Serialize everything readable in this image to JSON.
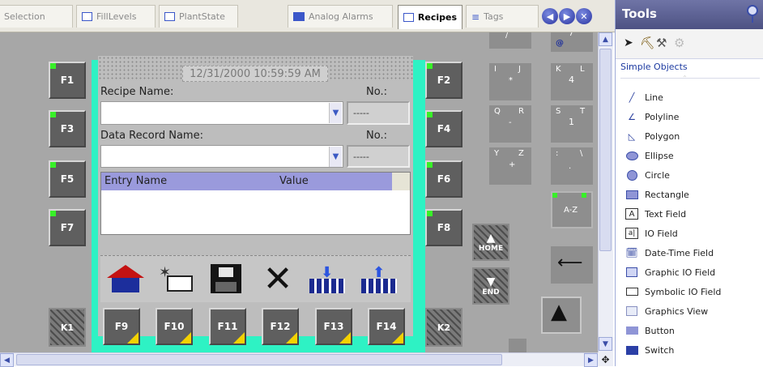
{
  "tabs": [
    {
      "label": "Selection",
      "active": false
    },
    {
      "label": "FillLevels",
      "active": false
    },
    {
      "label": "PlantState",
      "active": false
    },
    {
      "label": "Analog Alarms",
      "active": false
    },
    {
      "label": "Recipes",
      "active": true
    },
    {
      "label": "Tags",
      "active": false
    }
  ],
  "nav": {
    "back": "◀",
    "forward": "▶",
    "close": "✕"
  },
  "panel": {
    "left_keys": [
      "F1",
      "F3",
      "F5",
      "F7"
    ],
    "right_keys": [
      "F2",
      "F4",
      "F6",
      "F8"
    ],
    "bottom_keys": [
      "F9",
      "F10",
      "F11",
      "F12",
      "F13",
      "F14"
    ],
    "corner_keys": [
      "K1",
      "K2"
    ],
    "home_label": "HOME",
    "end_label": "END",
    "az_label": "A-Z"
  },
  "recipe_view": {
    "datetime": "12/31/2000 10:59:59 AM",
    "recipe_name_label": "Recipe Name:",
    "no_label_1": "No.:",
    "recipe_no_value": "-----",
    "record_name_label": "Data Record Name:",
    "no_label_2": "No.:",
    "record_no_value": "-----",
    "col_entry": "Entry Name",
    "col_value": "Value"
  },
  "keypad": {
    "k1": {
      "top": "I",
      "top2": "J",
      "mid": "*"
    },
    "k2": {
      "top": "K",
      "top2": "L",
      "mid": "4"
    },
    "k3": {
      "top": "Q",
      "top2": "R",
      "mid": "-"
    },
    "k4": {
      "top": "S",
      "top2": "T",
      "mid": "1"
    },
    "k5": {
      "top": "Y",
      "top2": "Z",
      "mid": "+"
    },
    "k6": {
      "top": ":",
      "top2": "\\",
      "mid": "."
    },
    "k0": {
      "top": "7",
      "mid": "@"
    }
  },
  "tools": {
    "title": "Tools",
    "category": "Simple Objects",
    "items": [
      "Line",
      "Polyline",
      "Polygon",
      "Ellipse",
      "Circle",
      "Rectangle",
      "Text Field",
      "IO Field",
      "Date-Time Field",
      "Graphic IO Field",
      "Symbolic IO Field",
      "Graphics View",
      "Button",
      "Switch"
    ]
  },
  "colors": {
    "accent": "#2ef2c4",
    "led": "#38f028",
    "tool_header": "#5c6196"
  }
}
